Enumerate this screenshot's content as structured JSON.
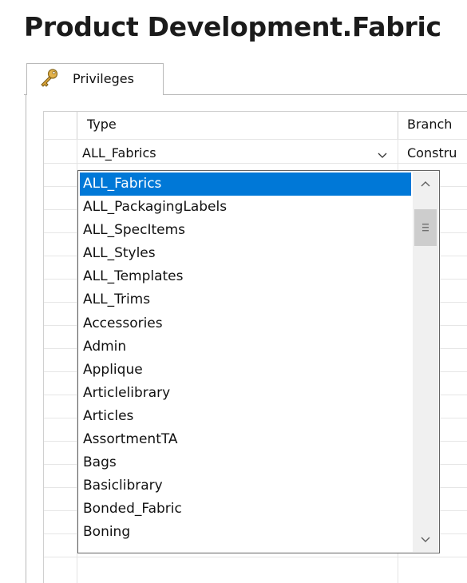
{
  "window": {
    "title": "Product Development.Fabric"
  },
  "tabs": [
    {
      "label": "Privileges",
      "icon": "key-icon",
      "active": true
    }
  ],
  "grid": {
    "columns": [
      {
        "label": "Type"
      },
      {
        "label": "Branch"
      }
    ],
    "rows": [
      {
        "type": "ALL_Fabrics",
        "branch": "Constru"
      }
    ]
  },
  "dropdown": {
    "selected": "ALL_Fabrics",
    "options": [
      "ALL_Fabrics",
      "ALL_PackagingLabels",
      "ALL_SpecItems",
      "ALL_Styles",
      "ALL_Templates",
      "ALL_Trims",
      "Accessories",
      "Admin",
      "Applique",
      "Articlelibrary",
      "Articles",
      "AssortmentTA",
      "Bags",
      "Basiclibrary",
      "Bonded_Fabric",
      "Boning"
    ],
    "scroll_position": 0.05
  },
  "colors": {
    "selection": "#0078d7",
    "scrollbar_track": "#f0f0f0",
    "scrollbar_thumb": "#cdcdcd"
  }
}
